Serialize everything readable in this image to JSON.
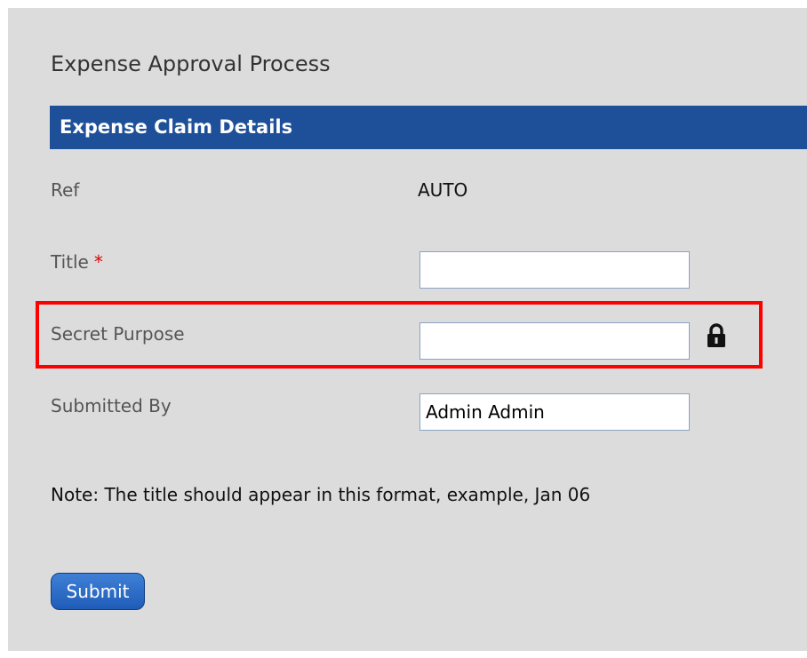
{
  "page": {
    "title": "Expense Approval Process"
  },
  "section": {
    "title": "Expense Claim Details"
  },
  "fields": {
    "ref": {
      "label": "Ref",
      "value": "AUTO"
    },
    "title": {
      "label": "Title",
      "required_marker": "*",
      "value": ""
    },
    "secret_purpose": {
      "label": "Secret Purpose",
      "value": "",
      "icon": "lock-icon"
    },
    "submitted_by": {
      "label": "Submitted By",
      "value": "Admin Admin"
    }
  },
  "note": "Note: The title should appear in this format, example, Jan 06",
  "actions": {
    "submit_label": "Submit"
  },
  "colors": {
    "panel_background": "#dcdcdc",
    "section_header": "#1e5099",
    "required": "#e00000",
    "highlight": "#ff0000",
    "button": "#2a69c6"
  }
}
